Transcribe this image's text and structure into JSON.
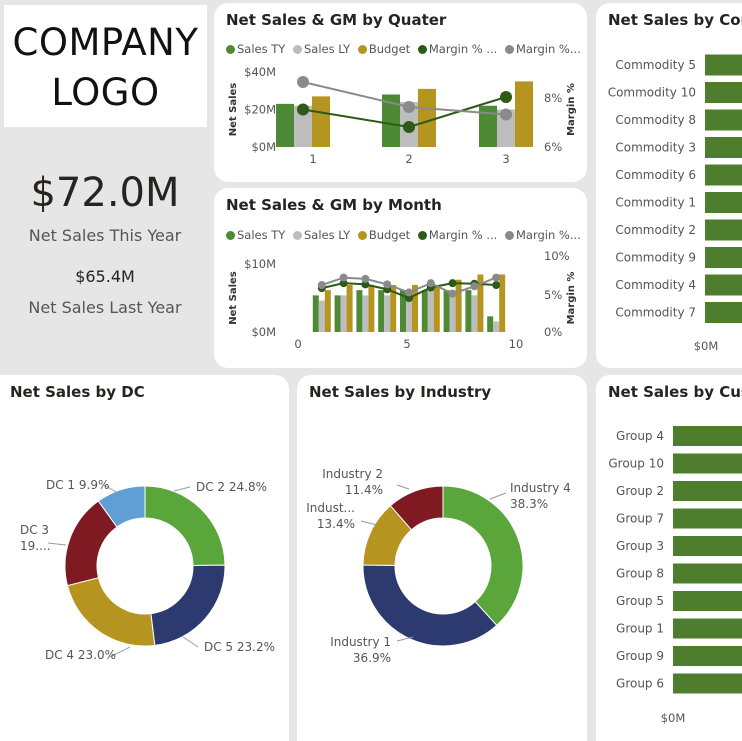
{
  "logo": {
    "line1": "COMPANY",
    "line2": "LOGO"
  },
  "kpi": {
    "ty_value": "$72.0M",
    "ty_label": "Net Sales This Year",
    "ly_value": "$65.4M",
    "ly_label": "Net Sales Last Year"
  },
  "colors": {
    "sales_ty": "#4e8a35",
    "sales_ly": "#bdbdbd",
    "budget": "#b5951f",
    "margin_ty": "#2d5a17",
    "margin_ly": "#8a8a8a",
    "dc": [
      "#5aa63b",
      "#2d3a70",
      "#b5951f",
      "#7f1a22",
      "#5f9fd6"
    ],
    "bar": "#4e7d2e"
  },
  "legend_labels": [
    "Sales TY",
    "Sales LY",
    "Budget",
    "Margin % ...",
    "Margin %..."
  ],
  "chart_data": [
    {
      "id": "quarter",
      "type": "bar",
      "title": "Net Sales & GM by Quater",
      "categories": [
        "1",
        "2",
        "3"
      ],
      "ylabel": "Net Sales",
      "y2label": "Margin %",
      "ylim": [
        0,
        40
      ],
      "yticks": [
        "$0M",
        "$20M",
        "$40M"
      ],
      "y2lim": [
        6,
        9
      ],
      "y2ticks": [
        "6%",
        "8%"
      ],
      "series": [
        {
          "name": "Sales TY",
          "kind": "bar",
          "values": [
            23,
            28,
            22
          ]
        },
        {
          "name": "Sales LY",
          "kind": "bar",
          "values": [
            22,
            24,
            20
          ]
        },
        {
          "name": "Budget",
          "kind": "bar",
          "values": [
            27,
            31,
            35
          ]
        },
        {
          "name": "Margin % ...",
          "kind": "line",
          "values": [
            7.5,
            6.8,
            8.0
          ]
        },
        {
          "name": "Margin %...",
          "kind": "line",
          "values": [
            8.6,
            7.6,
            7.3
          ]
        }
      ]
    },
    {
      "id": "month",
      "type": "bar",
      "title": "Net Sales & GM by Month",
      "x": [
        1,
        2,
        3,
        4,
        5,
        6,
        7,
        8,
        9
      ],
      "xticks": [
        "0",
        "5",
        "10"
      ],
      "xlim": [
        0,
        10
      ],
      "ylabel": "Net Sales",
      "y2label": "Margin %",
      "ylim": [
        0,
        13
      ],
      "yticks": [
        "$0M",
        "$10M"
      ],
      "y2lim": [
        0,
        11
      ],
      "y2ticks": [
        "0%",
        "5%",
        "10%"
      ],
      "series": [
        {
          "name": "Sales TY",
          "kind": "bar",
          "values": [
            7,
            7,
            8,
            8,
            8,
            8,
            8,
            8,
            3
          ]
        },
        {
          "name": "Sales LY",
          "kind": "bar",
          "values": [
            6,
            7,
            7,
            7,
            7,
            8,
            7,
            7,
            2
          ]
        },
        {
          "name": "Budget",
          "kind": "bar",
          "values": [
            8,
            9,
            9,
            9,
            9,
            9,
            10,
            11,
            11
          ]
        },
        {
          "name": "Margin % ...",
          "kind": "line",
          "values": [
            7.1,
            7.9,
            7.7,
            6.9,
            5.5,
            7.2,
            7.9,
            7.8,
            7.6
          ]
        },
        {
          "name": "Margin %...",
          "kind": "line",
          "values": [
            7.6,
            8.8,
            8.6,
            7.7,
            6.4,
            7.9,
            6.2,
            7.4,
            8.8
          ]
        }
      ]
    },
    {
      "id": "commodity",
      "type": "bar",
      "orientation": "horizontal",
      "title": "Net Sales by Com",
      "categories": [
        "Commodity 5",
        "Commodity 10",
        "Commodity 8",
        "Commodity 3",
        "Commodity 6",
        "Commodity 1",
        "Commodity 2",
        "Commodity 9",
        "Commodity 4",
        "Commodity 7"
      ],
      "values": [
        38,
        38,
        38,
        38,
        38,
        36,
        33,
        31,
        30,
        26
      ],
      "xticks": [
        "$0M"
      ]
    },
    {
      "id": "dc",
      "type": "pie",
      "title": "Net Sales by DC",
      "labels": [
        "DC 2",
        "DC 5",
        "DC 4",
        "DC 3",
        "DC 1"
      ],
      "values": [
        24.8,
        23.2,
        23.0,
        19.0,
        9.9
      ],
      "value_labels": [
        "24.8%",
        "23.2%",
        "23.0%",
        "19....",
        "9.9%"
      ]
    },
    {
      "id": "industry",
      "type": "pie",
      "title": "Net Sales by Industry",
      "labels": [
        "Industry 4",
        "Industry 1",
        "Indust...",
        "Industry 2"
      ],
      "values": [
        38.3,
        36.9,
        13.4,
        11.4
      ],
      "value_labels": [
        "38.3%",
        "36.9%",
        "13.4%",
        "11.4%"
      ]
    },
    {
      "id": "customer",
      "type": "bar",
      "orientation": "horizontal",
      "title": "Net Sales by Cust",
      "categories": [
        "Group 4",
        "Group 10",
        "Group 2",
        "Group 7",
        "Group 3",
        "Group 8",
        "Group 5",
        "Group 1",
        "Group 9",
        "Group 6"
      ],
      "values": [
        38,
        38,
        38,
        38,
        38,
        38,
        38,
        38,
        38,
        38
      ],
      "xticks": [
        "$0M"
      ]
    }
  ]
}
